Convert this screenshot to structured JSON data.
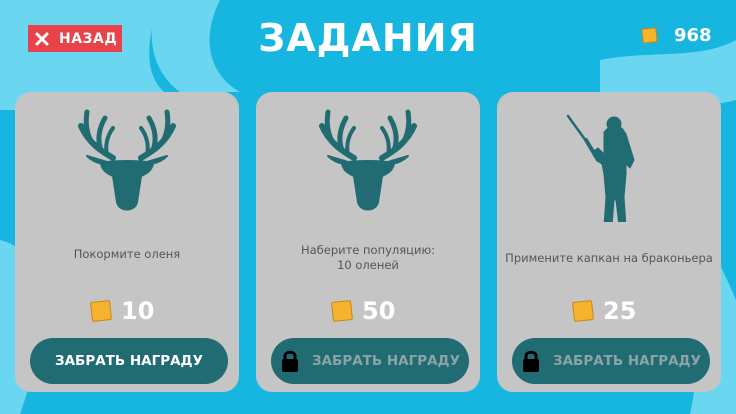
{
  "header": {
    "back_label": "НАЗАД",
    "title": "ЗАДАНИЯ",
    "coins": "968"
  },
  "colors": {
    "background": "#17b6e0",
    "accent_swirl": "#6ad6ef",
    "card": "#c5c5c5",
    "button": "#216b73",
    "silhouette": "#216b73",
    "coin": "#f6b32e",
    "back_button": "#e8424a"
  },
  "tasks": [
    {
      "icon": "deer-head-icon",
      "description": "Покормите оленя",
      "reward": "10",
      "button_label": "ЗАБРАТЬ НАГРАДУ",
      "locked": false
    },
    {
      "icon": "deer-head-icon",
      "description": "Наберите популяцию:\n10 оленей",
      "reward": "50",
      "button_label": "ЗАБРАТЬ НАГРАДУ",
      "locked": true
    },
    {
      "icon": "poacher-icon",
      "description": "Примените капкан на браконьера",
      "reward": "25",
      "button_label": "ЗАБРАТЬ НАГРАДУ",
      "locked": true
    }
  ]
}
